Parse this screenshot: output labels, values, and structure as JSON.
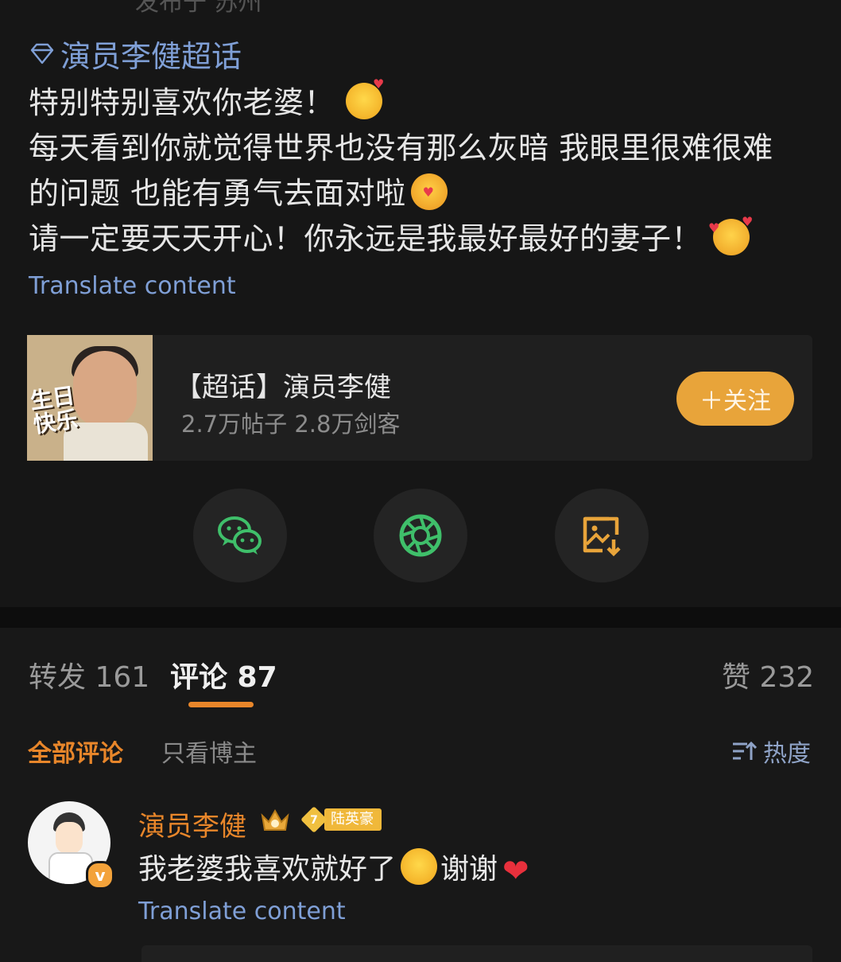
{
  "post": {
    "cut_top_text": "发布于 苏州",
    "super_topic_tag": "演员李健超话",
    "lines": [
      "特别特别喜欢你老婆！",
      "每天看到你就觉得世界也没有那么灰暗 我眼里很难很难",
      "的问题 也能有勇气去面对啦",
      "请一定要天天开心！你永远是我最好最好的妻子！"
    ],
    "emojis": [
      "happy-emoji",
      "hug-emoji",
      "smiling-hearts-emoji"
    ],
    "translate_label": "Translate content"
  },
  "topic_card": {
    "thumbnail_text": "生日快乐",
    "title": "【超话】演员李健",
    "subtitle": "2.7万帖子 2.8万剑客",
    "follow_label": "＋关注"
  },
  "share": [
    {
      "name": "wechat-icon",
      "color": "#3fbf6a"
    },
    {
      "name": "moments-icon",
      "color": "#3fbf6a"
    },
    {
      "name": "save-image-icon",
      "color": "#e8a43a"
    }
  ],
  "tabs": {
    "repost": "转发 161",
    "comments": "评论 87",
    "likes": "赞 232",
    "accent": "#e8862a"
  },
  "filters": {
    "all": "全部评论",
    "blogger_only": "只看博主",
    "sort": "热度"
  },
  "comment": {
    "author": "演员李健",
    "badge_level": "7",
    "badge_label": "陆英豪",
    "text_part1": "我老婆我喜欢就好了",
    "text_part2": "谢谢",
    "heart": "❤",
    "verify_mark": "v",
    "translate_label": "Translate content"
  }
}
